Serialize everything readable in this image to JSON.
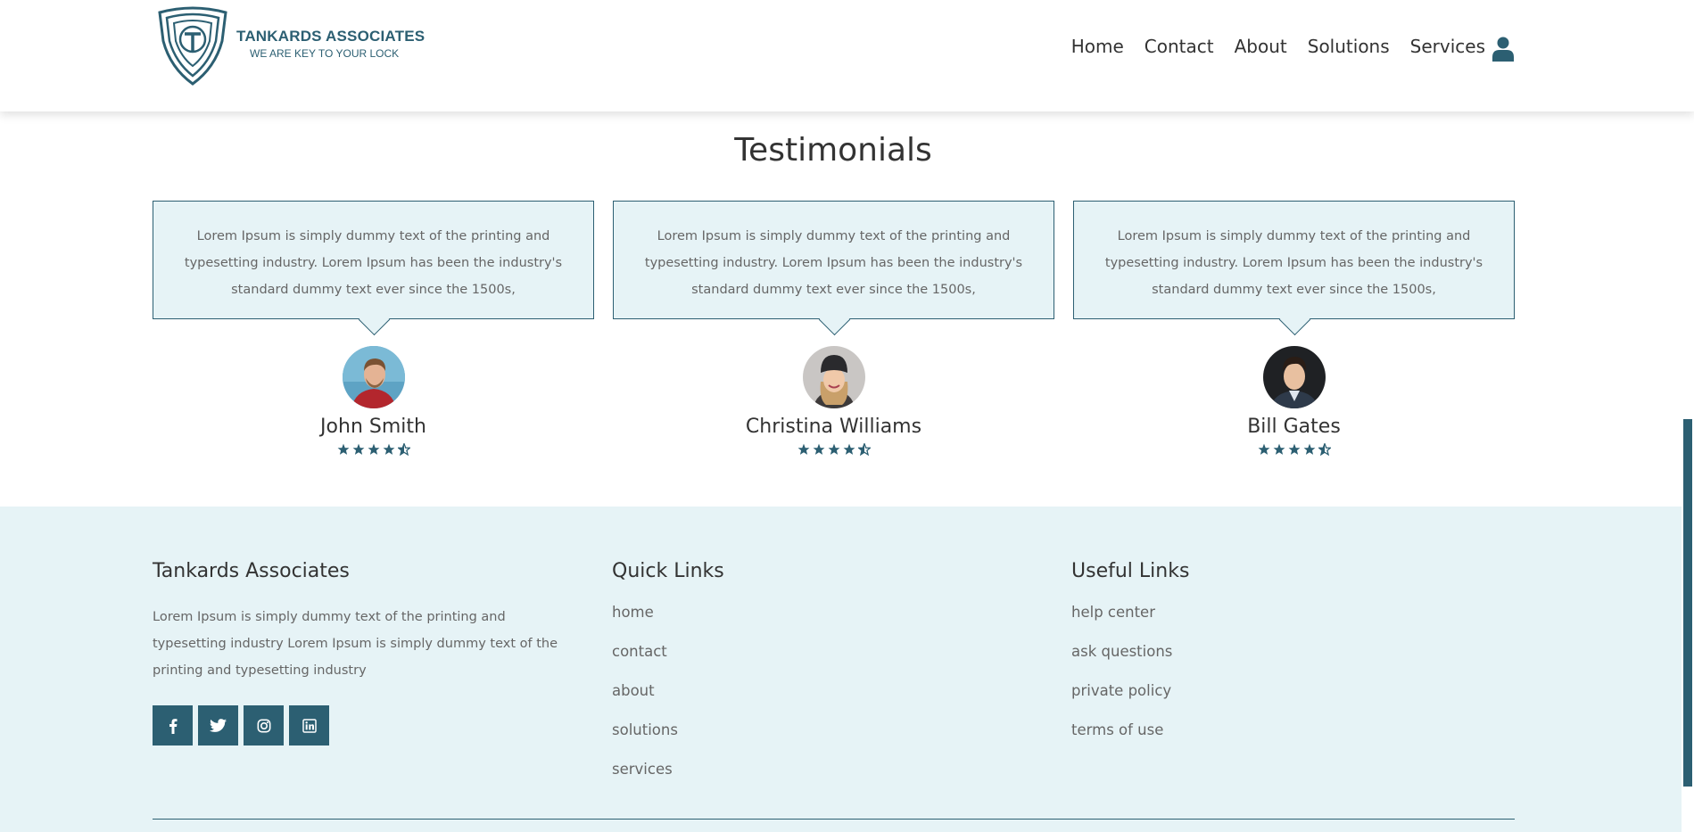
{
  "header": {
    "logo_name": "TANKARDS ASSOCIATES",
    "logo_tagline": "WE ARE KEY TO YOUR LOCK",
    "nav": [
      "Home",
      "Contact",
      "About",
      "Solutions",
      "Services"
    ],
    "user_icon": "user-icon"
  },
  "testimonials": {
    "title": "Testimonials",
    "items": [
      {
        "quote": "Lorem Ipsum is simply dummy text of the printing and typesetting industry. Lorem Ipsum has been the industry's standard dummy text ever since the 1500s,",
        "name": "John Smith",
        "rating": 4.5
      },
      {
        "quote": "Lorem Ipsum is simply dummy text of the printing and typesetting industry. Lorem Ipsum has been the industry's standard dummy text ever since the 1500s,",
        "name": "Christina Williams",
        "rating": 4.5
      },
      {
        "quote": "Lorem Ipsum is simply dummy text of the printing and typesetting industry. Lorem Ipsum has been the industry's standard dummy text ever since the 1500s,",
        "name": "Bill Gates",
        "rating": 4.5
      }
    ]
  },
  "footer": {
    "about": {
      "title": "Tankards Associates",
      "text": "Lorem Ipsum is simply dummy text of the printing and typesetting industry Lorem Ipsum is simply dummy text of the printing and typesetting industry"
    },
    "social_icons": [
      "facebook-icon",
      "twitter-icon",
      "instagram-icon",
      "linkedin-icon"
    ],
    "quick_links": {
      "title": "Quick Links",
      "items": [
        "home",
        "contact",
        "about",
        "solutions",
        "services"
      ]
    },
    "useful_links": {
      "title": "Useful Links",
      "items": [
        "help center",
        "ask questions",
        "private policy",
        "terms of use"
      ]
    }
  },
  "colors": {
    "brand": "#2c5f72",
    "light_bg": "#e6f3f6"
  }
}
